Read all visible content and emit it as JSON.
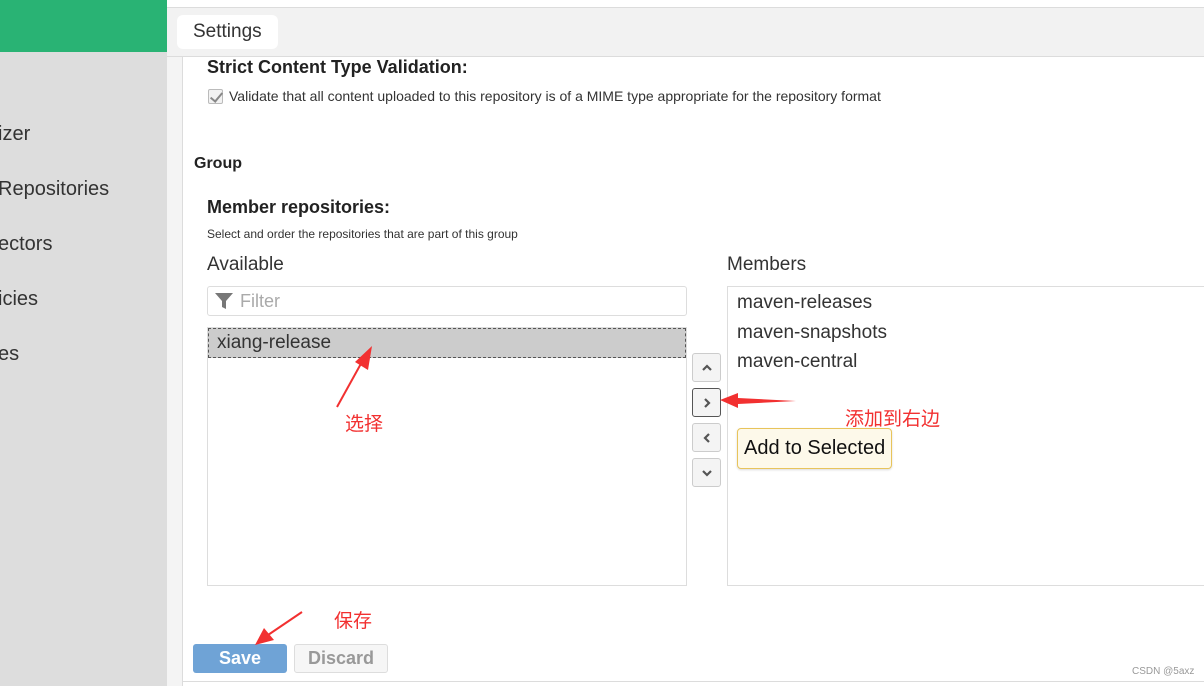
{
  "sidebar": {
    "items": [
      {
        "label": "izer"
      },
      {
        "label": "Repositories"
      },
      {
        "label": "ectors"
      },
      {
        "label": "icies"
      },
      {
        "label": "es"
      }
    ]
  },
  "tabs": [
    {
      "label": "Settings"
    }
  ],
  "strict": {
    "heading": "Strict Content Type Validation:",
    "checkbox_label": "Validate that all content uploaded to this repository is of a MIME type appropriate for the repository format",
    "checked": true
  },
  "group": {
    "heading": "Group",
    "member_heading": "Member repositories:",
    "member_sub": "Select and order the repositories that are part of this group",
    "available_label": "Available",
    "members_label": "Members",
    "filter_placeholder": "Filter",
    "available": [
      "xiang-release"
    ],
    "members": [
      "maven-releases",
      "maven-snapshots",
      "maven-central"
    ],
    "buttons": {
      "up": "Move Up",
      "add": "Add to Selected",
      "remove": "Remove from Selected",
      "down": "Move Down"
    },
    "tooltip": "Add to Selected"
  },
  "actions": {
    "save": "Save",
    "discard": "Discard"
  },
  "annotations": {
    "select": "选择",
    "add_right": "添加到右边",
    "save": "保存"
  },
  "watermark": "CSDN @5axz",
  "colors": {
    "brand": "#29b374",
    "save": "#6fa3d6",
    "annotation": "#f23030"
  }
}
